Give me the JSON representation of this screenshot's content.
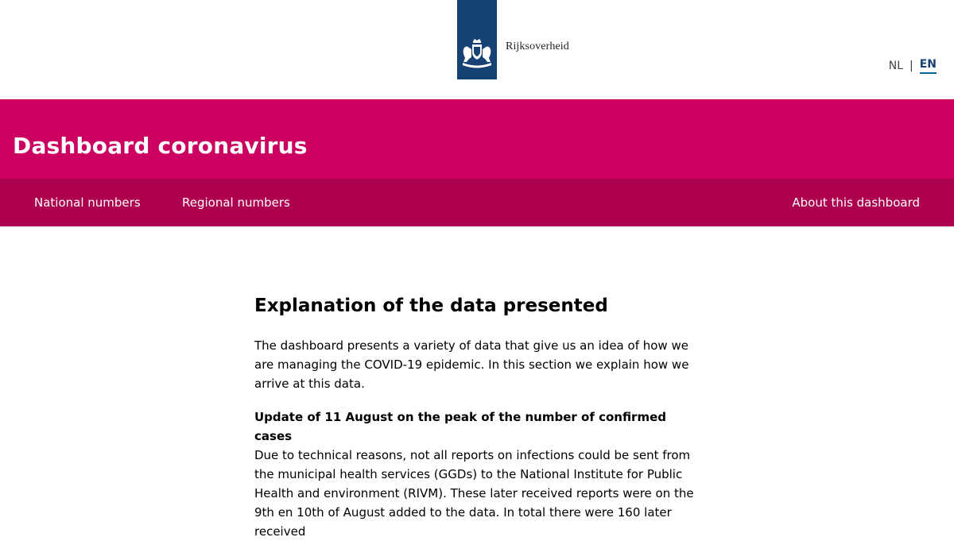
{
  "header": {
    "logo_text": "Rijksoverheid",
    "lang_nl": "NL",
    "lang_separator": "|",
    "lang_en": "EN"
  },
  "banner": {
    "title": "Dashboard coronavirus"
  },
  "nav": {
    "items": [
      {
        "label": "National numbers"
      },
      {
        "label": "Regional numbers"
      },
      {
        "label": "About this dashboard"
      }
    ]
  },
  "main": {
    "heading": "Explanation of the data presented",
    "intro": "The dashboard presents a variety of data that give us an idea of how we are managing the COVID-19 epidemic. In this section we explain how we arrive at this data.",
    "update_title": "Update of 11 August on the peak of the number of confirmed cases",
    "update_body": "Due to technical reasons, not all reports on infections could be sent from the municipal health services (GGDs) to the National Institute for Public Health and environment (RIVM). These later received reports were on the 9th en 10th of August added to the data. In total there were 160 later received"
  },
  "colors": {
    "logo_blue": "#154273",
    "banner_magenta": "#cb0060",
    "nav_magenta_dark": "#ad004e",
    "lang_active_underline": "#01689b"
  },
  "icons": {
    "logo": "dutch-coat-of-arms-icon"
  }
}
